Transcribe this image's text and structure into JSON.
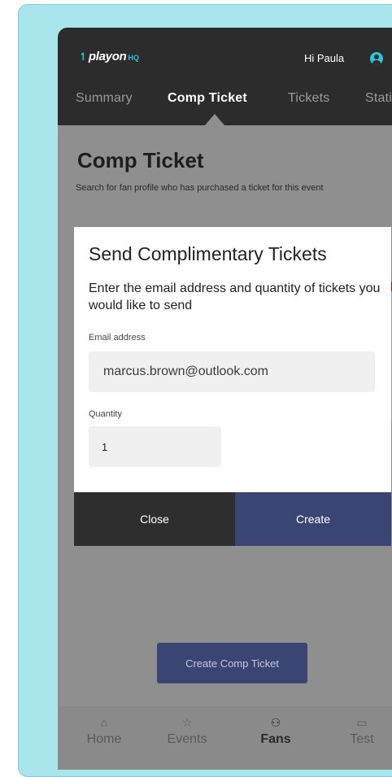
{
  "header": {
    "logo_text": "playon",
    "logo_suffix": "HQ",
    "greeting": "Hi Paula",
    "user_icon": "user-circle-icon"
  },
  "tabs": [
    {
      "label": "Summary",
      "active": false
    },
    {
      "label": "Comp Ticket",
      "active": true
    },
    {
      "label": "Tickets",
      "active": false
    },
    {
      "label": "Statist",
      "active": false
    }
  ],
  "page": {
    "title": "Comp Ticket",
    "subtitle": "Search for fan profile who has purchased a ticket for this event"
  },
  "modal": {
    "title": "Send Complimentary Tickets",
    "description": "Enter the email address and quantity of tickets you would like to send",
    "email_label": "Email address",
    "email_value": "marcus.brown@outlook.com",
    "quantity_label": "Quantity",
    "quantity_value": "1",
    "close_label": "Close",
    "create_label": "Create"
  },
  "create_comp_button": "Create Comp Ticket",
  "bottom_nav": [
    {
      "label": "Home",
      "icon": "home-icon",
      "active": false
    },
    {
      "label": "Events",
      "icon": "events-icon",
      "active": false
    },
    {
      "label": "Fans",
      "icon": "fans-icon",
      "active": true
    },
    {
      "label": "Test",
      "icon": "video-icon",
      "active": false
    }
  ],
  "colors": {
    "frame": "#a8e6ec",
    "accent": "#2ec4d6",
    "primary_button": "#3b4573",
    "header": "#2c2c2c"
  }
}
